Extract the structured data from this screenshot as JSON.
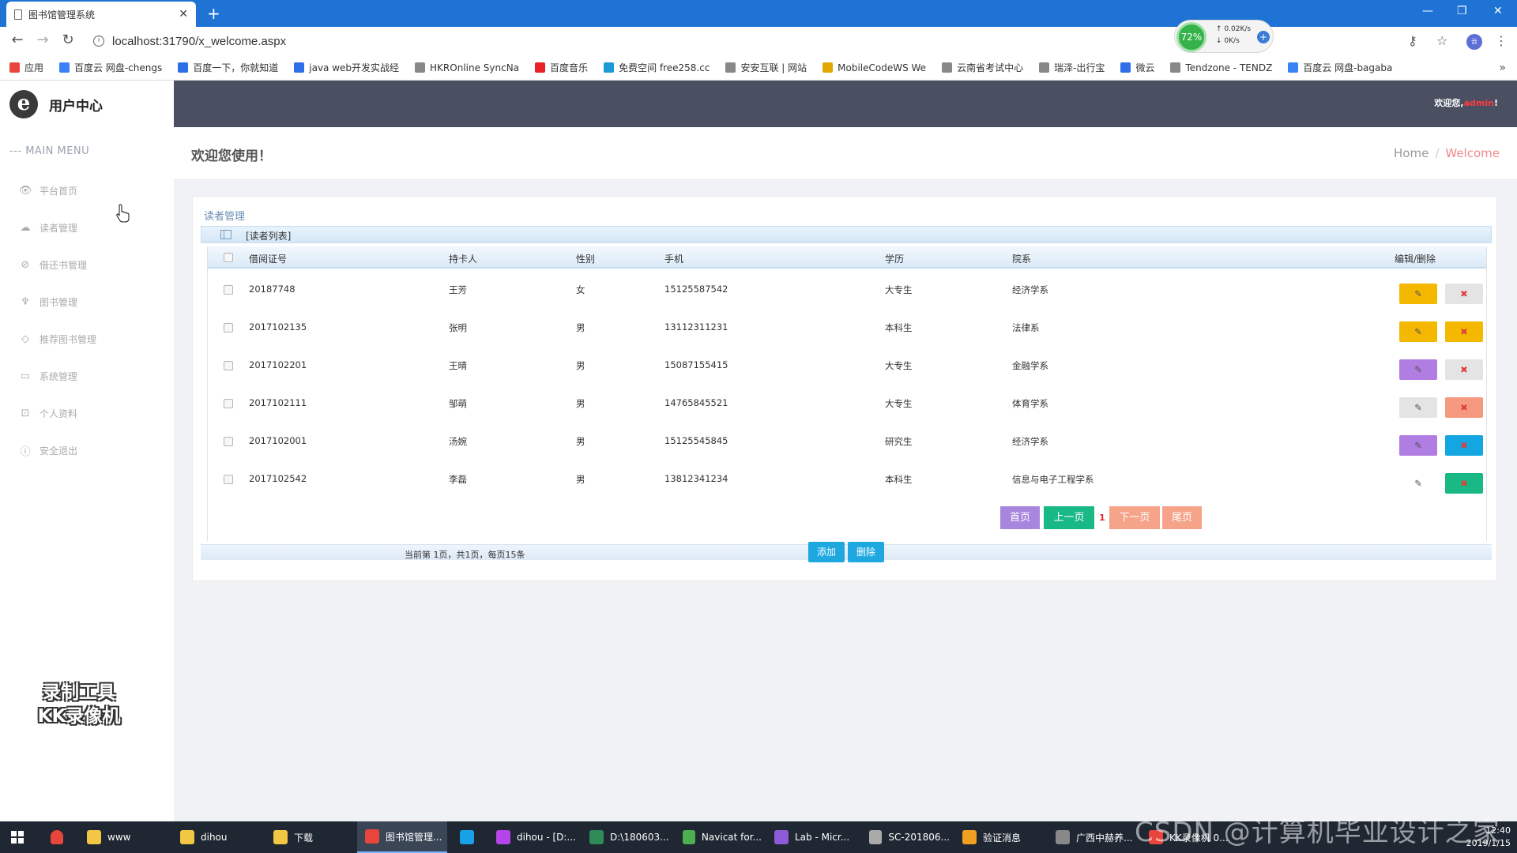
{
  "browser": {
    "tab_title": "图书馆管理系统",
    "url": "localhost:31790/x_welcome.aspx",
    "speed": {
      "percent": "72%",
      "up": "0.02K/s",
      "down": "0K/s"
    },
    "bookmarks": [
      {
        "label": "应用",
        "color": "#e8453c"
      },
      {
        "label": "百度云 网盘-chengs",
        "color": "#3b82f6"
      },
      {
        "label": "百度一下，你就知道",
        "color": "#2d6fe6"
      },
      {
        "label": "java web开发实战经",
        "color": "#2d6fe6"
      },
      {
        "label": "HKROnline SyncNa",
        "color": "#888888"
      },
      {
        "label": "百度音乐",
        "color": "#e8202a"
      },
      {
        "label": "免费空间 free258.cc",
        "color": "#1b9ad6"
      },
      {
        "label": "安安互联 | 网站",
        "color": "#888888"
      },
      {
        "label": "MobileCodeWS We",
        "color": "#e2a800"
      },
      {
        "label": "云南省考试中心",
        "color": "#888888"
      },
      {
        "label": "瑞泽-出行宝",
        "color": "#888888"
      },
      {
        "label": "微云",
        "color": "#2d6fe6"
      },
      {
        "label": "Tendzone - TENDZ",
        "color": "#888888"
      },
      {
        "label": "百度云 网盘-bagaba",
        "color": "#3b82f6"
      }
    ]
  },
  "sidebar": {
    "logo_letter": "e",
    "brand": "用户中心",
    "menu_head": "--- MAIN MENU",
    "items": [
      {
        "label": "平台首页",
        "icon": "eye-icon",
        "glyph": "👁"
      },
      {
        "label": "读者管理",
        "icon": "cloud-upload-icon",
        "glyph": "☁"
      },
      {
        "label": "借还书管理",
        "icon": "compass-icon",
        "glyph": "⊘"
      },
      {
        "label": "图书管理",
        "icon": "trophy-icon",
        "glyph": "♆"
      },
      {
        "label": "推荐图书管理",
        "icon": "diamond-icon",
        "glyph": "◇"
      },
      {
        "label": "系统管理",
        "icon": "monitor-icon",
        "glyph": "▭"
      },
      {
        "label": "个人资料",
        "icon": "screen-icon",
        "glyph": "⊡"
      },
      {
        "label": "安全退出",
        "icon": "info-icon",
        "glyph": "ⓘ"
      }
    ],
    "watermark_line1": "录制工具",
    "watermark_line2": "KK录像机"
  },
  "topbar": {
    "welcome_prefix": "欢迎您,",
    "username": "admin",
    "welcome_suffix": "!"
  },
  "page": {
    "title": "欢迎您使用！",
    "breadcrumb": {
      "home": "Home",
      "sep": "/",
      "current": "Welcome"
    }
  },
  "panel": {
    "tag": "读者管理",
    "list_title": "[读者列表]",
    "columns": [
      "借阅证号",
      "持卡人",
      "性别",
      "手机",
      "学历",
      "院系",
      "编辑/删除"
    ],
    "rows": [
      {
        "id": "20187748",
        "name": "王芳",
        "gender": "女",
        "phone": "15125587542",
        "edu": "大专生",
        "dept": "经济学系",
        "edit_color": "#f5b800",
        "del_color": "#e4e4e4"
      },
      {
        "id": "2017102135",
        "name": "张明",
        "gender": "男",
        "phone": "13112311231",
        "edu": "本科生",
        "dept": "法律系",
        "edit_color": "#f5b800",
        "del_color": "#f5b800"
      },
      {
        "id": "2017102201",
        "name": "王晴",
        "gender": "男",
        "phone": "15087155415",
        "edu": "大专生",
        "dept": "金融学系",
        "edit_color": "#b07de3",
        "del_color": "#e4e4e4"
      },
      {
        "id": "2017102111",
        "name": "邹萌",
        "gender": "男",
        "phone": "14765845521",
        "edu": "大专生",
        "dept": "体育学系",
        "edit_color": "#e4e4e4",
        "del_color": "#f59a80"
      },
      {
        "id": "2017102001",
        "name": "汤婉",
        "gender": "男",
        "phone": "15125545845",
        "edu": "研究生",
        "dept": "经济学系",
        "edit_color": "#b07de3",
        "del_color": "#14a6e3"
      },
      {
        "id": "2017102542",
        "name": "李磊",
        "gender": "男",
        "phone": "13812341234",
        "edu": "本科生",
        "dept": "信息与电子工程学系",
        "edit_color": "#ffffff",
        "del_color": "#19b985"
      }
    ],
    "edit_glyph": "✎",
    "del_glyph": "✖",
    "pager_info": "当前第 1页，共1页，每页15条",
    "pager": {
      "first": "首页",
      "prev": "上一页",
      "page": "1",
      "next": "下一页",
      "last": "尾页"
    },
    "add_label": "添加",
    "delete_label": "删除"
  },
  "taskbar": {
    "items": [
      {
        "label": "www",
        "color": "#f2c744"
      },
      {
        "label": "dihou",
        "color": "#f2c744"
      },
      {
        "label": "下载",
        "color": "#f2c744"
      },
      {
        "label": "图书馆管理...",
        "color": "#e8453c"
      },
      {
        "label": "",
        "color": "#1aa0e8"
      },
      {
        "label": "dihou - [D:...",
        "color": "#b545e8"
      },
      {
        "label": "D:\\180603...",
        "color": "#2e8b57"
      },
      {
        "label": "Navicat for...",
        "color": "#4caf50"
      },
      {
        "label": "Lab - Micr...",
        "color": "#8e5bd8"
      },
      {
        "label": "SC-201806...",
        "color": "#aaaaaa"
      },
      {
        "label": "验证消息",
        "color": "#f0a020"
      },
      {
        "label": "广西中赫养...",
        "color": "#888888"
      },
      {
        "label": "KK录像机 0...",
        "color": "#e8453c"
      }
    ],
    "time": "12:40",
    "date": "2019/1/15"
  },
  "overlay_text": "CSDN @计算机毕业设计之家"
}
